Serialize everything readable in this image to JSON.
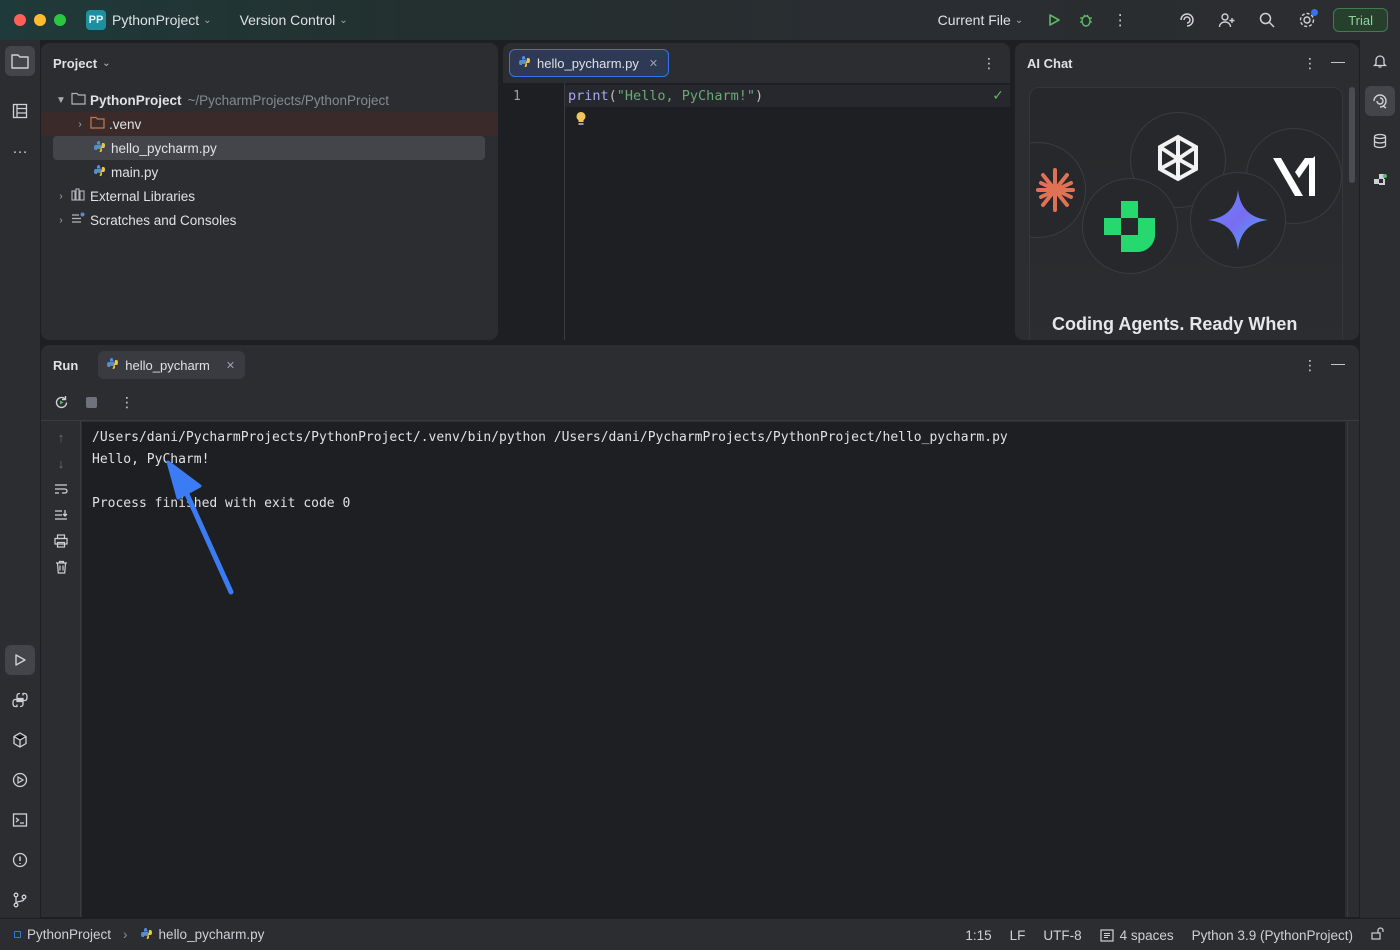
{
  "titlebar": {
    "project_badge": "PP",
    "project_name": "PythonProject",
    "vcs_label": "Version Control",
    "run_config": "Current File",
    "trial_label": "Trial"
  },
  "project_panel": {
    "title": "Project",
    "tree": [
      {
        "label": "PythonProject",
        "path": "~/PycharmProjects/PythonProject"
      },
      {
        "label": ".venv"
      },
      {
        "label": "hello_pycharm.py"
      },
      {
        "label": "main.py"
      },
      {
        "label": "External Libraries"
      },
      {
        "label": "Scratches and Consoles"
      }
    ]
  },
  "editor": {
    "tab_label": "hello_pycharm.py",
    "line_number": "1",
    "code": {
      "fn": "print",
      "open": "(",
      "str": "\"Hello, PyCharm!\"",
      "close": ")"
    }
  },
  "ai_chat": {
    "title": "AI Chat",
    "card_heading": "Coding Agents. Ready When"
  },
  "run_panel": {
    "title": "Run",
    "tab_label": "hello_pycharm",
    "console": [
      "/Users/dani/PycharmProjects/PythonProject/.venv/bin/python /Users/dani/PycharmProjects/PythonProject/hello_pycharm.py",
      "Hello, PyCharm!",
      "",
      "Process finished with exit code 0"
    ]
  },
  "statusbar": {
    "breadcrumb_project": "PythonProject",
    "breadcrumb_file": "hello_pycharm.py",
    "position": "1:15",
    "line_ending": "LF",
    "encoding": "UTF-8",
    "indent": "4 spaces",
    "interpreter": "Python 3.9 (PythonProject)"
  },
  "colors": {
    "accent": "#3574f0",
    "annotation_arrow": "#3b7cf5",
    "string": "#6aab73",
    "function": "#a9a9f2"
  }
}
